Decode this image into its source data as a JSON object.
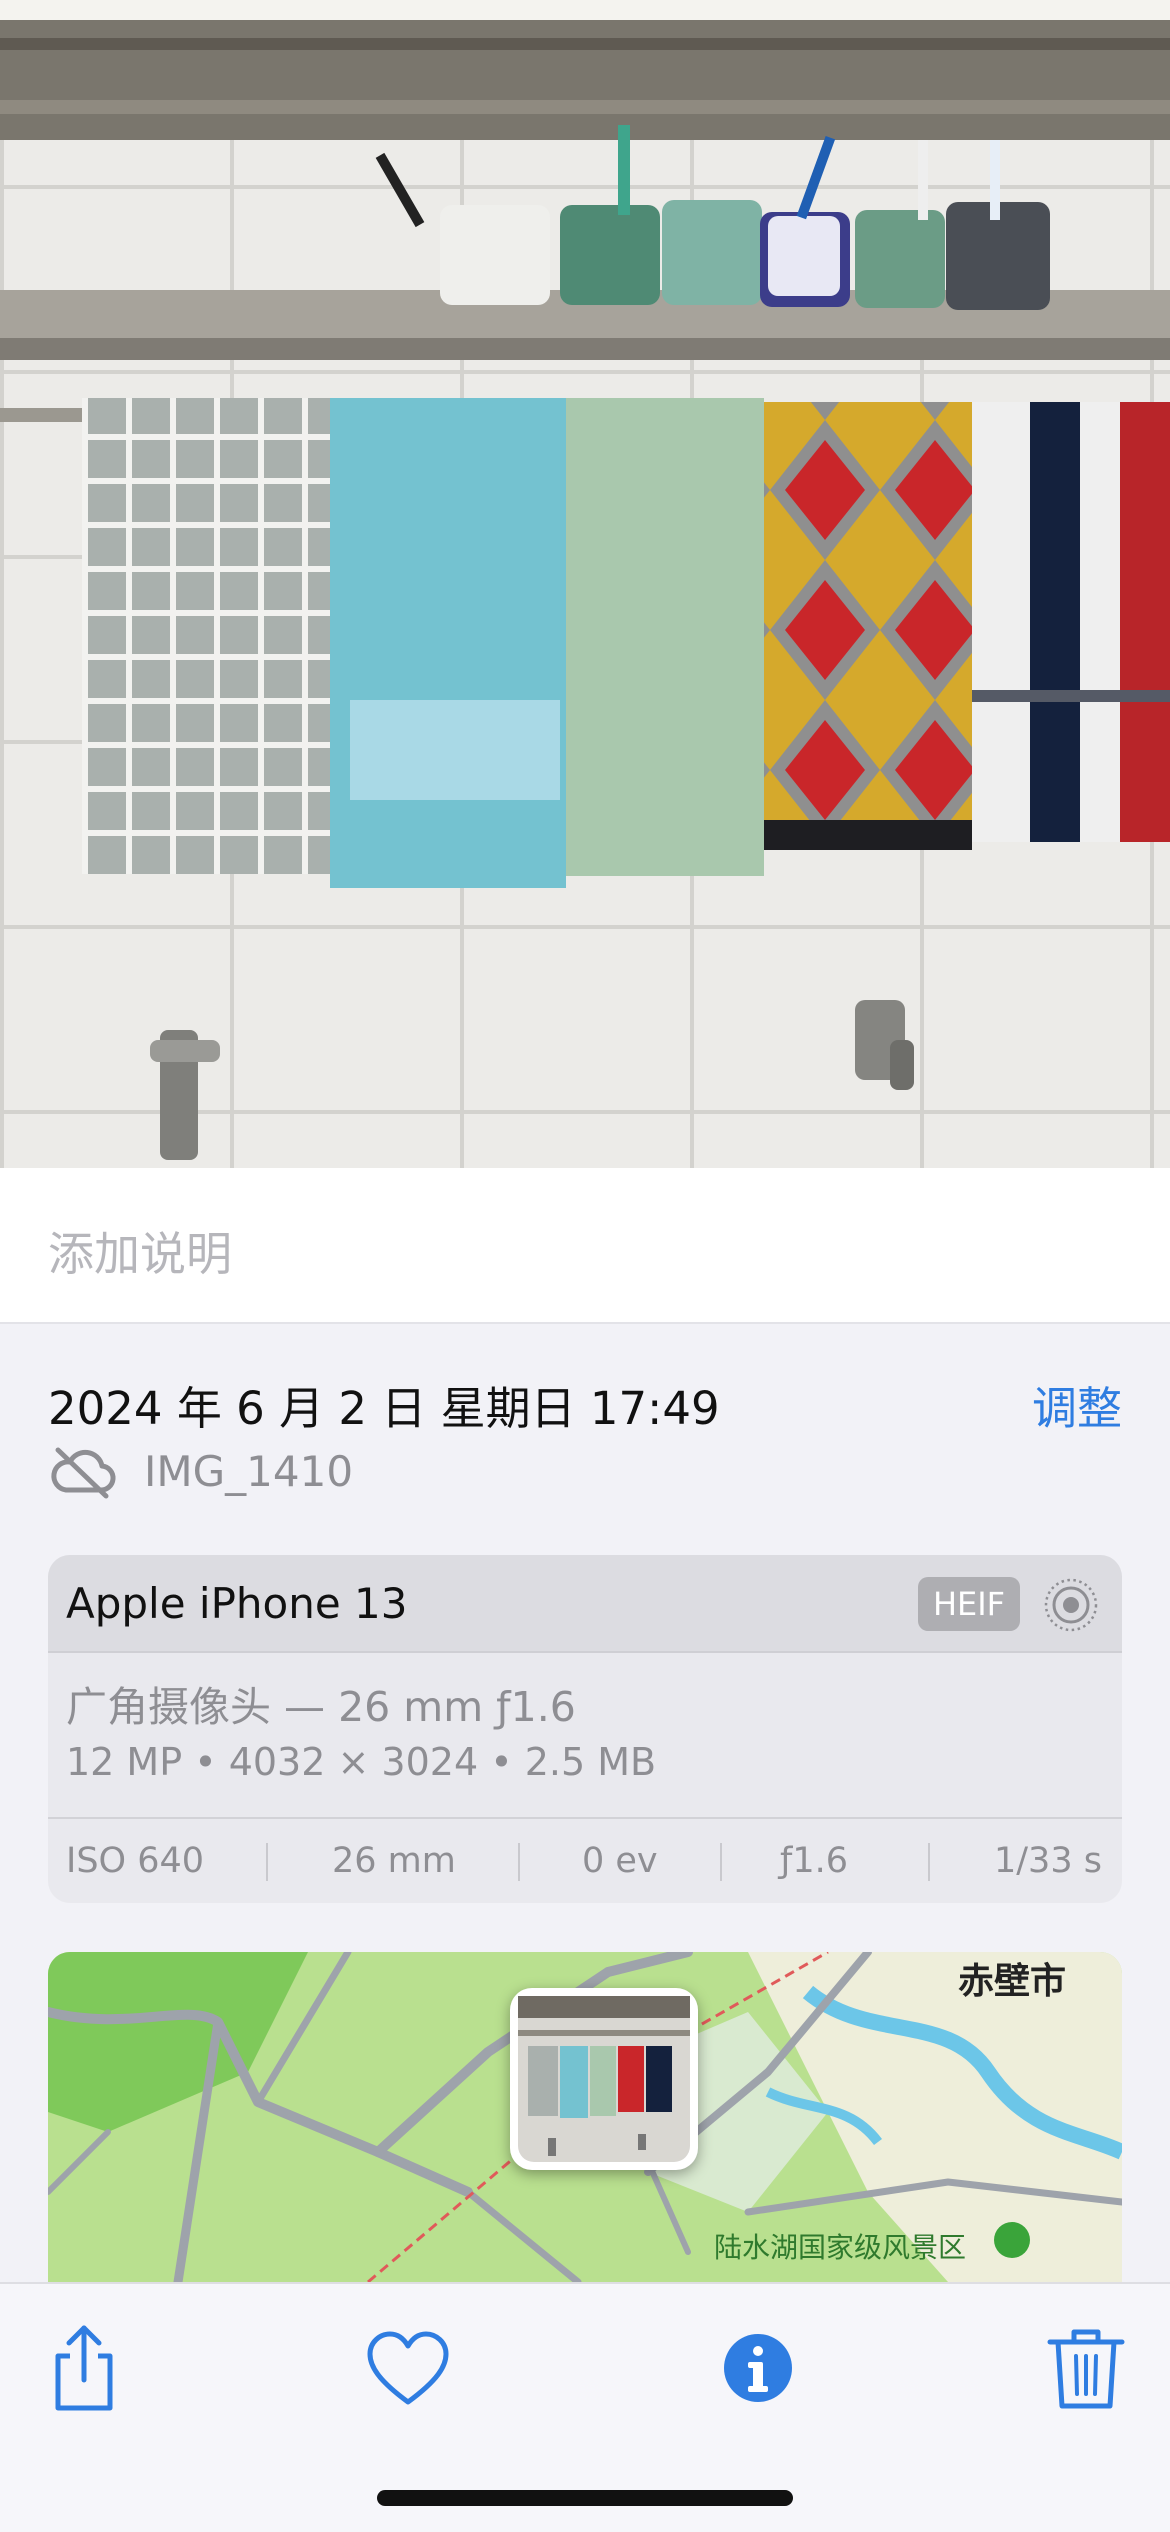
{
  "caption": {
    "placeholder": "添加说明"
  },
  "info": {
    "datetime": "2024 年 6 月 2 日  星期日  17:49",
    "adjust_label": "调整",
    "filename": "IMG_1410"
  },
  "camera": {
    "device": "Apple iPhone 13",
    "format_badge": "HEIF",
    "lens": "广角摄像头 — 26 mm ƒ1.6",
    "specs": "12 MP  •  4032 × 3024  •  2.5 MB",
    "exif": {
      "iso": "ISO 640",
      "focal": "26 mm",
      "ev": "0 ev",
      "aperture": "ƒ1.6",
      "shutter": "1/33 s"
    }
  },
  "map": {
    "city_label": "赤壁市",
    "park_label": "陆水湖国家级风景区"
  },
  "toolbar": {
    "share_icon": "share-icon",
    "favorite_icon": "heart-icon",
    "info_icon": "info-icon",
    "delete_icon": "trash-icon",
    "accent_color": "#2f7de1"
  }
}
